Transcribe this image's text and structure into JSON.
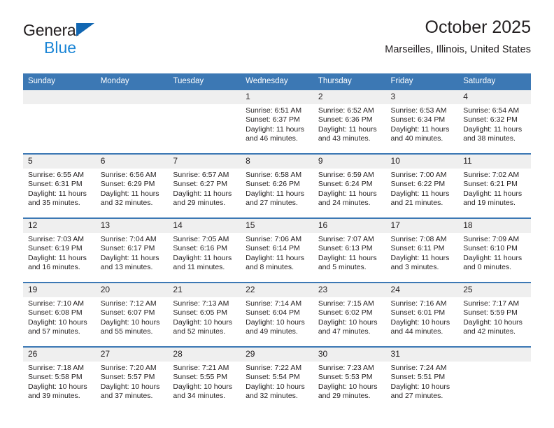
{
  "brand": {
    "word1": "General",
    "word2": "Blue",
    "logo_icon": "triangle-logo-icon",
    "accent_dark": "#1267b2",
    "accent_light": "#1c86d6"
  },
  "header": {
    "title": "October 2025",
    "subtitle": "Marseilles, Illinois, United States"
  },
  "theme": {
    "header_blue": "#3c78b4",
    "daynum_bg": "#efefef",
    "text": "#231f20"
  },
  "weekday_headers": [
    "Sunday",
    "Monday",
    "Tuesday",
    "Wednesday",
    "Thursday",
    "Friday",
    "Saturday"
  ],
  "labels": {
    "sunrise": "Sunrise:",
    "sunset": "Sunset:",
    "daylight": "Daylight:"
  },
  "weeks": [
    [
      {
        "day": "",
        "empty": true
      },
      {
        "day": "",
        "empty": true
      },
      {
        "day": "",
        "empty": true
      },
      {
        "day": "1",
        "sunrise": "Sunrise: 6:51 AM",
        "sunset": "Sunset: 6:37 PM",
        "daylight1": "Daylight: 11 hours",
        "daylight2": "and 46 minutes."
      },
      {
        "day": "2",
        "sunrise": "Sunrise: 6:52 AM",
        "sunset": "Sunset: 6:36 PM",
        "daylight1": "Daylight: 11 hours",
        "daylight2": "and 43 minutes."
      },
      {
        "day": "3",
        "sunrise": "Sunrise: 6:53 AM",
        "sunset": "Sunset: 6:34 PM",
        "daylight1": "Daylight: 11 hours",
        "daylight2": "and 40 minutes."
      },
      {
        "day": "4",
        "sunrise": "Sunrise: 6:54 AM",
        "sunset": "Sunset: 6:32 PM",
        "daylight1": "Daylight: 11 hours",
        "daylight2": "and 38 minutes."
      }
    ],
    [
      {
        "day": "5",
        "sunrise": "Sunrise: 6:55 AM",
        "sunset": "Sunset: 6:31 PM",
        "daylight1": "Daylight: 11 hours",
        "daylight2": "and 35 minutes."
      },
      {
        "day": "6",
        "sunrise": "Sunrise: 6:56 AM",
        "sunset": "Sunset: 6:29 PM",
        "daylight1": "Daylight: 11 hours",
        "daylight2": "and 32 minutes."
      },
      {
        "day": "7",
        "sunrise": "Sunrise: 6:57 AM",
        "sunset": "Sunset: 6:27 PM",
        "daylight1": "Daylight: 11 hours",
        "daylight2": "and 29 minutes."
      },
      {
        "day": "8",
        "sunrise": "Sunrise: 6:58 AM",
        "sunset": "Sunset: 6:26 PM",
        "daylight1": "Daylight: 11 hours",
        "daylight2": "and 27 minutes."
      },
      {
        "day": "9",
        "sunrise": "Sunrise: 6:59 AM",
        "sunset": "Sunset: 6:24 PM",
        "daylight1": "Daylight: 11 hours",
        "daylight2": "and 24 minutes."
      },
      {
        "day": "10",
        "sunrise": "Sunrise: 7:00 AM",
        "sunset": "Sunset: 6:22 PM",
        "daylight1": "Daylight: 11 hours",
        "daylight2": "and 21 minutes."
      },
      {
        "day": "11",
        "sunrise": "Sunrise: 7:02 AM",
        "sunset": "Sunset: 6:21 PM",
        "daylight1": "Daylight: 11 hours",
        "daylight2": "and 19 minutes."
      }
    ],
    [
      {
        "day": "12",
        "sunrise": "Sunrise: 7:03 AM",
        "sunset": "Sunset: 6:19 PM",
        "daylight1": "Daylight: 11 hours",
        "daylight2": "and 16 minutes."
      },
      {
        "day": "13",
        "sunrise": "Sunrise: 7:04 AM",
        "sunset": "Sunset: 6:17 PM",
        "daylight1": "Daylight: 11 hours",
        "daylight2": "and 13 minutes."
      },
      {
        "day": "14",
        "sunrise": "Sunrise: 7:05 AM",
        "sunset": "Sunset: 6:16 PM",
        "daylight1": "Daylight: 11 hours",
        "daylight2": "and 11 minutes."
      },
      {
        "day": "15",
        "sunrise": "Sunrise: 7:06 AM",
        "sunset": "Sunset: 6:14 PM",
        "daylight1": "Daylight: 11 hours",
        "daylight2": "and 8 minutes."
      },
      {
        "day": "16",
        "sunrise": "Sunrise: 7:07 AM",
        "sunset": "Sunset: 6:13 PM",
        "daylight1": "Daylight: 11 hours",
        "daylight2": "and 5 minutes."
      },
      {
        "day": "17",
        "sunrise": "Sunrise: 7:08 AM",
        "sunset": "Sunset: 6:11 PM",
        "daylight1": "Daylight: 11 hours",
        "daylight2": "and 3 minutes."
      },
      {
        "day": "18",
        "sunrise": "Sunrise: 7:09 AM",
        "sunset": "Sunset: 6:10 PM",
        "daylight1": "Daylight: 11 hours",
        "daylight2": "and 0 minutes."
      }
    ],
    [
      {
        "day": "19",
        "sunrise": "Sunrise: 7:10 AM",
        "sunset": "Sunset: 6:08 PM",
        "daylight1": "Daylight: 10 hours",
        "daylight2": "and 57 minutes."
      },
      {
        "day": "20",
        "sunrise": "Sunrise: 7:12 AM",
        "sunset": "Sunset: 6:07 PM",
        "daylight1": "Daylight: 10 hours",
        "daylight2": "and 55 minutes."
      },
      {
        "day": "21",
        "sunrise": "Sunrise: 7:13 AM",
        "sunset": "Sunset: 6:05 PM",
        "daylight1": "Daylight: 10 hours",
        "daylight2": "and 52 minutes."
      },
      {
        "day": "22",
        "sunrise": "Sunrise: 7:14 AM",
        "sunset": "Sunset: 6:04 PM",
        "daylight1": "Daylight: 10 hours",
        "daylight2": "and 49 minutes."
      },
      {
        "day": "23",
        "sunrise": "Sunrise: 7:15 AM",
        "sunset": "Sunset: 6:02 PM",
        "daylight1": "Daylight: 10 hours",
        "daylight2": "and 47 minutes."
      },
      {
        "day": "24",
        "sunrise": "Sunrise: 7:16 AM",
        "sunset": "Sunset: 6:01 PM",
        "daylight1": "Daylight: 10 hours",
        "daylight2": "and 44 minutes."
      },
      {
        "day": "25",
        "sunrise": "Sunrise: 7:17 AM",
        "sunset": "Sunset: 5:59 PM",
        "daylight1": "Daylight: 10 hours",
        "daylight2": "and 42 minutes."
      }
    ],
    [
      {
        "day": "26",
        "sunrise": "Sunrise: 7:18 AM",
        "sunset": "Sunset: 5:58 PM",
        "daylight1": "Daylight: 10 hours",
        "daylight2": "and 39 minutes."
      },
      {
        "day": "27",
        "sunrise": "Sunrise: 7:20 AM",
        "sunset": "Sunset: 5:57 PM",
        "daylight1": "Daylight: 10 hours",
        "daylight2": "and 37 minutes."
      },
      {
        "day": "28",
        "sunrise": "Sunrise: 7:21 AM",
        "sunset": "Sunset: 5:55 PM",
        "daylight1": "Daylight: 10 hours",
        "daylight2": "and 34 minutes."
      },
      {
        "day": "29",
        "sunrise": "Sunrise: 7:22 AM",
        "sunset": "Sunset: 5:54 PM",
        "daylight1": "Daylight: 10 hours",
        "daylight2": "and 32 minutes."
      },
      {
        "day": "30",
        "sunrise": "Sunrise: 7:23 AM",
        "sunset": "Sunset: 5:53 PM",
        "daylight1": "Daylight: 10 hours",
        "daylight2": "and 29 minutes."
      },
      {
        "day": "31",
        "sunrise": "Sunrise: 7:24 AM",
        "sunset": "Sunset: 5:51 PM",
        "daylight1": "Daylight: 10 hours",
        "daylight2": "and 27 minutes."
      },
      {
        "day": "",
        "empty": true
      }
    ]
  ]
}
